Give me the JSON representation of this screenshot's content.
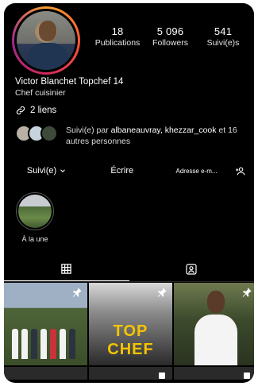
{
  "profile": {
    "name": "Victor Blanchet Topchef 14",
    "bio": "Chef cuisinier",
    "links_label": "2 liens"
  },
  "stats": [
    {
      "value": "18",
      "label": "Publications"
    },
    {
      "value": "5 096",
      "label": "Followers"
    },
    {
      "value": "541",
      "label": "Suivi(e)s"
    }
  ],
  "followed_by": {
    "prefix": "Suivi(e) par ",
    "names": "albaneauvray, khezzar_cook",
    "suffix": " et 16 autres personnes"
  },
  "actions": {
    "follow_label": "Suivi(e)",
    "write_label": "Écrire",
    "address_label": "Adresse e-m..."
  },
  "highlight": {
    "label": "À la une"
  },
  "posts": [
    {
      "id": "post-1",
      "pinned": true
    },
    {
      "id": "post-2",
      "pinned": true,
      "text": "TOP CHEF"
    },
    {
      "id": "post-3",
      "pinned": true
    }
  ],
  "colors": {
    "background": "#000000",
    "text": "#ffffff",
    "ring_start": "#f9a12e",
    "ring_end": "#a0288f",
    "top_chef_yellow": "#f5c400"
  },
  "icons": {
    "link": "link-icon",
    "add_person": "add-person-icon",
    "grid": "grid-icon",
    "tagged": "tagged-icon",
    "pin": "pin-icon",
    "multi": "multi-photo-icon",
    "chevron": "chevron-down-icon"
  }
}
